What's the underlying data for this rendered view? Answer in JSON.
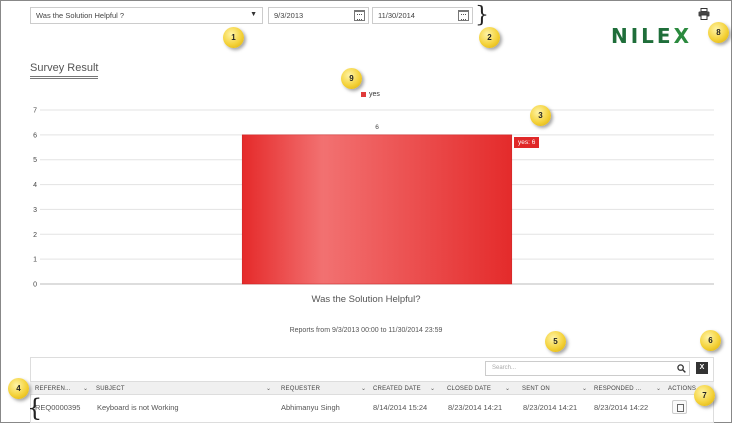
{
  "filters": {
    "question_value": "Was the Solution Helpful ?",
    "date_from": "9/3/2013",
    "date_to": "11/30/2014"
  },
  "brand": {
    "logo_main": "NILE",
    "logo_x": "X"
  },
  "callouts": [
    "1",
    "2",
    "3",
    "4",
    "5",
    "6",
    "7",
    "8",
    "9"
  ],
  "section": {
    "title": "Survey Result"
  },
  "legend": {
    "label": "yes",
    "color": "#e03a3a"
  },
  "chart_data": {
    "type": "bar",
    "categories": [
      "yes"
    ],
    "values": [
      6
    ],
    "title": "Was the Solution Helpful?",
    "xlabel": "",
    "ylabel": "",
    "ylim": [
      0,
      7
    ],
    "yticks": [
      0,
      1,
      2,
      3,
      4,
      5,
      6,
      7
    ],
    "data_labels": [
      "6"
    ],
    "tooltip": "yes: 6",
    "grid": true,
    "legend_position": "top-center",
    "colors": {
      "bar": "#e83434",
      "bar_highlight": "#f06b6b"
    }
  },
  "report": {
    "range_text": "Reports from 9/3/2013 00:00 to 11/30/2014 23:59"
  },
  "grid": {
    "search_placeholder": "Search...",
    "excel_label": "X",
    "columns": [
      "REFEREN...",
      "SUBJECT",
      "REQUESTER",
      "CREATED DATE",
      "CLOSED DATE",
      "SENT ON",
      "RESPONDED ...",
      "ACTIONS"
    ],
    "rows": [
      {
        "reference": "REQ0000395",
        "subject": "Keyboard is not Working",
        "requester": "Abhimanyu Singh",
        "created": "8/14/2014 15:24",
        "closed": "8/23/2014 14:21",
        "sent": "8/23/2014 14:21",
        "responded": "8/23/2014 14:22"
      }
    ]
  }
}
